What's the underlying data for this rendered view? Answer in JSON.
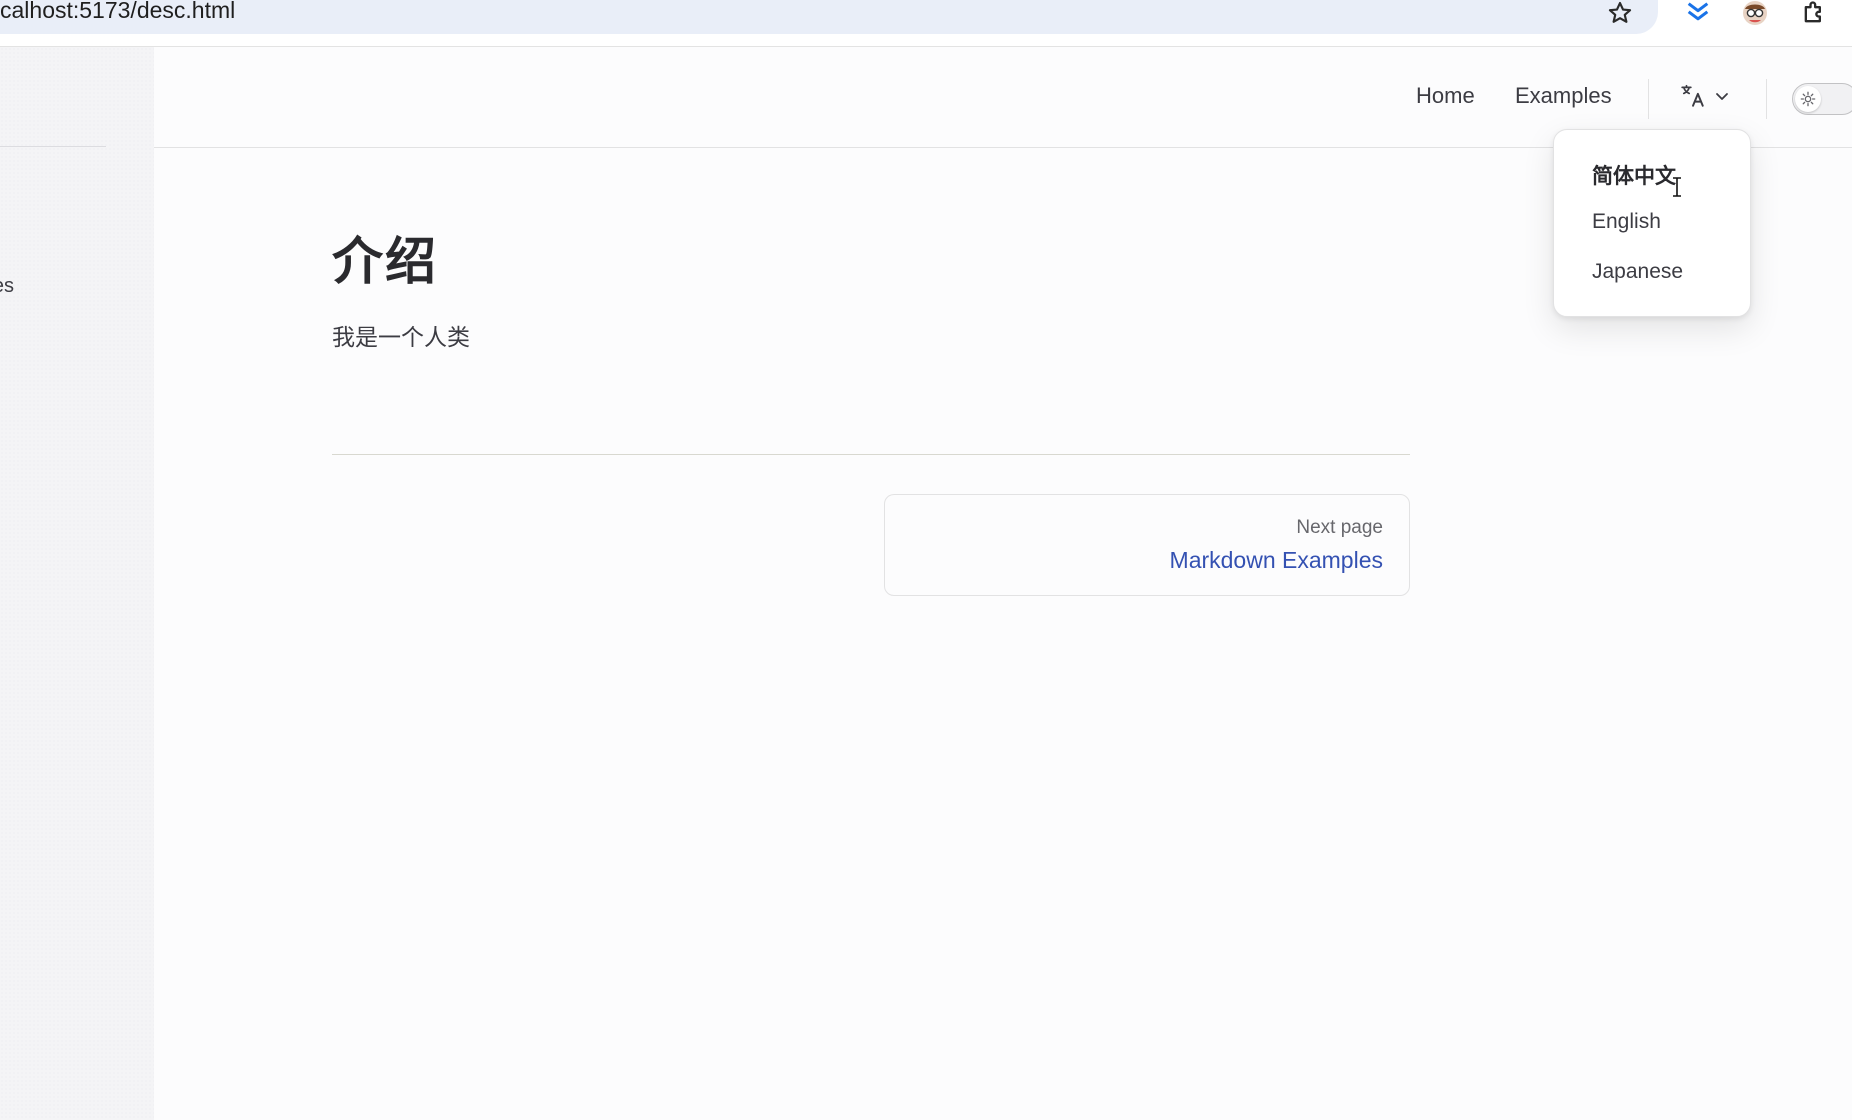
{
  "browser": {
    "url": "calhost:5173/desc.html",
    "icons": [
      "star-icon",
      "bookmark-down-icon",
      "profile-avatar-icon",
      "extensions-icon"
    ]
  },
  "sidebar": {
    "items": [
      {
        "label": "es"
      }
    ]
  },
  "nav": {
    "links": [
      {
        "label": "Home"
      },
      {
        "label": "Examples"
      }
    ],
    "language_icon": "translate-icon",
    "theme_icon": "sun-icon"
  },
  "language_menu": {
    "items": [
      {
        "label": "简体中文",
        "active": true
      },
      {
        "label": "English",
        "active": false
      },
      {
        "label": "Japanese",
        "active": false
      }
    ]
  },
  "content": {
    "title": "介绍",
    "body": "我是一个人类",
    "next": {
      "label": "Next page",
      "title": "Markdown Examples"
    }
  },
  "colors": {
    "accent_link": "#3451b2",
    "text": "#3c3c43",
    "url_bar": "#e9eef8",
    "bookmark_icon": "#1a73e8"
  }
}
